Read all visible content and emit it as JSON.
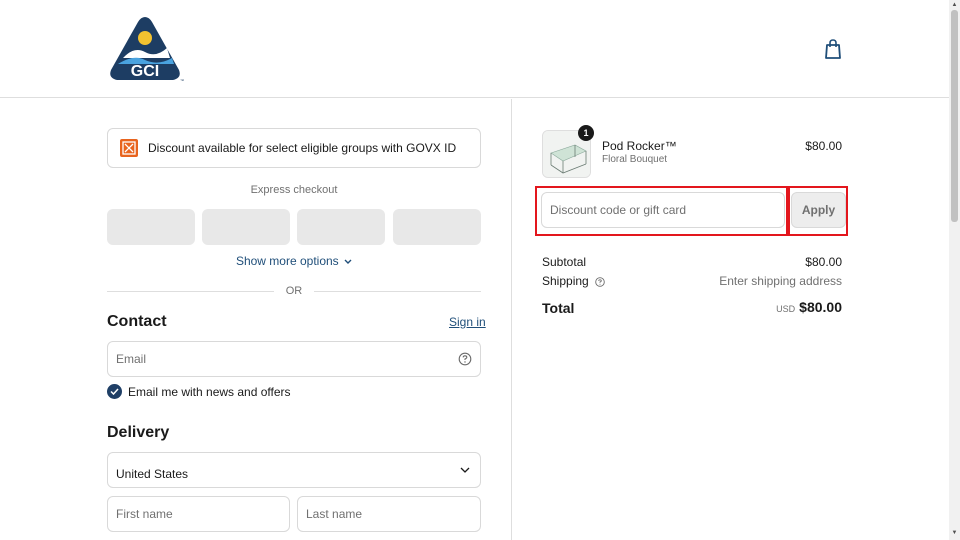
{
  "header": {
    "logo_text": "GCI",
    "cart_icon": "shopping-bag-icon"
  },
  "checkout": {
    "banner": {
      "text": "Discount available for select eligible groups with GOVX ID",
      "icon": "govx-icon"
    },
    "express_title": "Express checkout",
    "show_more": "Show more options",
    "or_text": "OR",
    "contact": {
      "heading": "Contact",
      "sign_in": "Sign in",
      "email_placeholder": "Email",
      "newsletter_label": "Email me with news and offers",
      "newsletter_checked": true
    },
    "delivery": {
      "heading": "Delivery",
      "country": "United States",
      "first_name_placeholder": "First name",
      "last_name_placeholder": "Last name"
    }
  },
  "summary": {
    "item": {
      "name": "Pod Rocker™",
      "variant": "Floral Bouquet",
      "price": "$80.00",
      "qty": "1"
    },
    "discount_placeholder": "Discount code or gift card",
    "apply_label": "Apply",
    "subtotal_label": "Subtotal",
    "subtotal_value": "$80.00",
    "shipping_label": "Shipping",
    "shipping_value": "Enter shipping address",
    "total_label": "Total",
    "total_currency": "USD",
    "total_value": "$80.00"
  },
  "colors": {
    "brand_navy": "#1f3f66",
    "link": "#1f4e79",
    "highlight": "#e3161d"
  }
}
